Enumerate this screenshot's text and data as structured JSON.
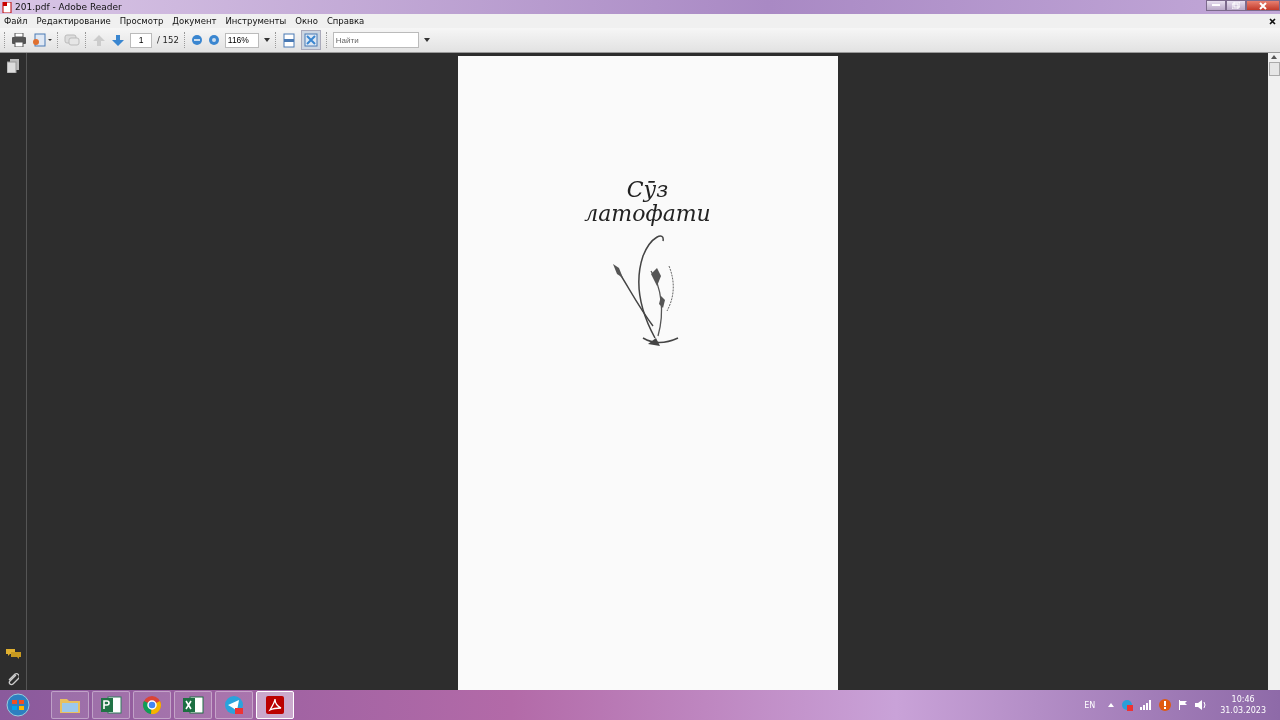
{
  "window": {
    "title": "201.pdf - Adobe Reader"
  },
  "menu": [
    "Файл",
    "Редактирование",
    "Просмотр",
    "Документ",
    "Инструменты",
    "Окно",
    "Справка"
  ],
  "toolbar": {
    "page": "1",
    "page_total": "/ 152",
    "zoom": "116%",
    "search": {
      "placeholder": "Найти"
    }
  },
  "document": {
    "title_lines": [
      "Сӯз",
      "латофати"
    ]
  },
  "taskbar": {
    "apps": [
      {
        "kind": "folder",
        "selected": false
      },
      {
        "kind": "project",
        "selected": false
      },
      {
        "kind": "chrome",
        "selected": false
      },
      {
        "kind": "excel",
        "selected": false
      },
      {
        "kind": "telegram",
        "selected": false
      },
      {
        "kind": "reader",
        "selected": true
      }
    ],
    "language": "EN",
    "time": "10:46",
    "date": "31.03.2023"
  }
}
